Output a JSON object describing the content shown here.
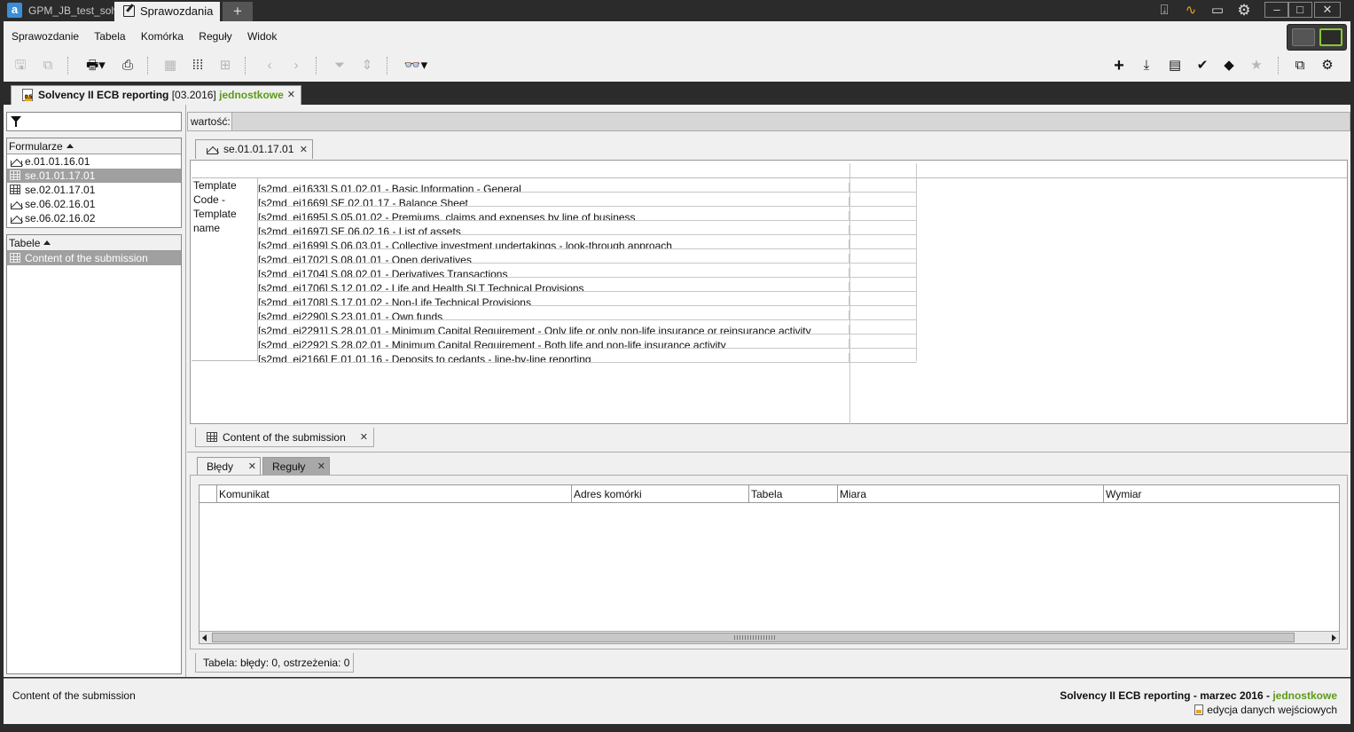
{
  "titlebar": {
    "inactive_tab": "GPM_JB_test_solv",
    "active_tab": "Sprawozdania",
    "plus": "+",
    "colors": {
      "bg": "#2b2b2b",
      "accent_orange": "#e8a326"
    }
  },
  "menu": {
    "items": [
      "Sprawozdanie",
      "Tabela",
      "Komórka",
      "Reguły",
      "Widok"
    ]
  },
  "document_tab": {
    "title": "Solvency II ECB reporting",
    "period": "[03.2016]",
    "scope": "jednostkowe"
  },
  "left_panel": {
    "formularze_header": "Formularze",
    "forms": [
      "e.01.01.16.01",
      "se.01.01.17.01",
      "se.02.01.17.01",
      "se.06.02.16.01",
      "se.06.02.16.02"
    ],
    "selected_form": "se.01.01.17.01",
    "tabele_header": "Tabele",
    "tables": [
      "Content of the submission"
    ]
  },
  "value_bar": {
    "label": "wartość:"
  },
  "form_tab": {
    "label": "se.01.01.17.01"
  },
  "grid": {
    "row_label": "Template Code - Template name",
    "rows": [
      "[s2md_ei1633] S.01.02.01 - Basic Information - General",
      "[s2md_ei1669] SE.02.01.17 - Balance Sheet",
      "[s2md_ei1695] S.05.01.02 - Premiums, claims and expenses by line of business",
      "[s2md_ei1697] SE.06.02.16 - List of assets",
      "[s2md_ei1699] S.06.03.01 - Collective investment undertakings - look-through approach",
      "[s2md_ei1702] S.08.01.01 - Open derivatives",
      "[s2md_ei1704] S.08.02.01 - Derivatives Transactions",
      "[s2md_ei1706] S.12.01.02 - Life and Health SLT Technical Provisions",
      "[s2md_ei1708] S.17.01.02 - Non-Life Technical Provisions",
      "[s2md_ei2290] S.23.01.01 - Own funds",
      "[s2md_ei2291] S.28.01.01 - Minimum Capital Requirement - Only life or only non-life insurance or reinsurance activity",
      "[s2md_ei2292] S.28.02.01 - Minimum Capital Requirement - Both life and non-life insurance activity",
      "[s2md_ei2166] E.01.01.16 - Deposits to cedants - line-by-line reporting"
    ]
  },
  "table_tab": {
    "label": "Content of the submission"
  },
  "errors": {
    "tab_errors": "Błędy",
    "tab_rules": "Reguły",
    "columns": [
      "Komunikat",
      "Adres komórki",
      "Tabela",
      "Miara",
      "Wymiar"
    ],
    "summary": "Tabela: błędy: 0, ostrzeżenia: 0"
  },
  "statusbar": {
    "left": "Content of the submission",
    "right_title": "Solvency II ECB reporting - marzec 2016 - ",
    "right_scope": "jednostkowe",
    "right_mode": "edycja danych wejściowych"
  }
}
